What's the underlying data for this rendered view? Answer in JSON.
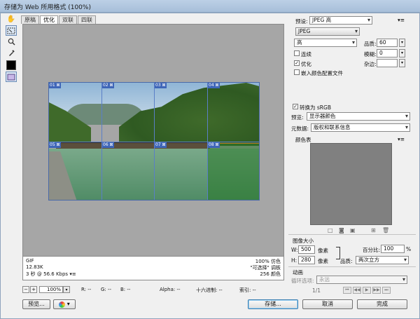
{
  "window": {
    "title": "存储为 Web 所用格式 (100%)"
  },
  "tools": [
    {
      "name": "hand-tool-icon",
      "glyph": "✋"
    },
    {
      "name": "slice-select-tool-icon",
      "glyph": "⬚"
    },
    {
      "name": "zoom-tool-icon",
      "glyph": "🔍"
    },
    {
      "name": "eyedropper-tool-icon",
      "glyph": "✎"
    }
  ],
  "eyedropper_color": "#000000",
  "tabs": [
    "原稿",
    "优化",
    "双联",
    "四联"
  ],
  "active_tab": "优化",
  "slices": [
    "01",
    "02",
    "03",
    "04",
    "05",
    "06",
    "07",
    "08"
  ],
  "info": {
    "format": "GIF",
    "size": "12.83K",
    "time": "3 秒 @ 56.6 Kbps",
    "dither": "100% 仿色",
    "palette": "\"可选择\" 调板",
    "colors": "256 颜色"
  },
  "status": {
    "zoom": "100%",
    "r": "R: --",
    "g": "G: --",
    "b": "B: --",
    "alpha": "Alpha: --",
    "hex": "十六进制: --",
    "index": "索引: --"
  },
  "buttons": {
    "preview": "预览...",
    "save": "存储...",
    "cancel": "取消",
    "done": "完成"
  },
  "settings": {
    "preset_label": "预设:",
    "preset_value": "JPEG 高",
    "format": "JPEG",
    "compression": "高",
    "quality_label": "品质:",
    "quality_value": "60",
    "progressive": "连续",
    "blur_label": "模糊:",
    "blur_value": "0",
    "optimized": "优化",
    "matte_label": "杂边:",
    "embed_profile": "嵌入颜色配置文件",
    "convert_srgb": "转换为 sRGB",
    "preview_label": "预览:",
    "preview_value": "显示器颜色",
    "metadata_label": "元数据:",
    "metadata_value": "版权和联系信息",
    "color_table_label": "颜色表"
  },
  "image_size": {
    "section": "图像大小",
    "w_label": "W:",
    "w_value": "500",
    "h_label": "H:",
    "h_value": "280",
    "unit": "像素",
    "percent_label": "百分比:",
    "percent_value": "100",
    "percent_unit": "%",
    "quality_label": "品质:",
    "quality_value": "两次立方"
  },
  "animation": {
    "section": "动画",
    "loop_label": "循环选项:",
    "loop_value": "永远",
    "frame": "1/1"
  }
}
